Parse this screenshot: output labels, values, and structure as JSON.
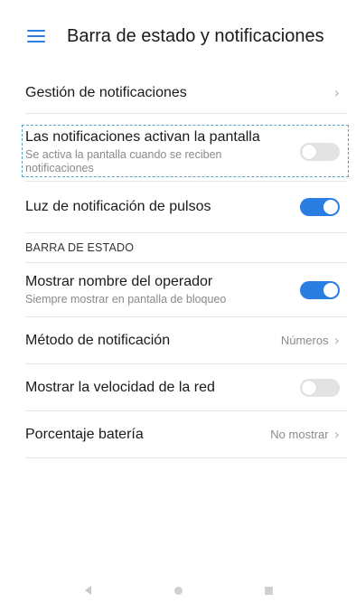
{
  "header": {
    "title": "Barra de estado y notificaciones"
  },
  "rows": {
    "notification_management": {
      "label": "Gestión de notificaciones"
    },
    "notifications_wake_screen": {
      "label": "Las notificaciones activan la pantalla",
      "sub": "Se activa la pantalla cuando se reciben notificaciones",
      "toggle": "off"
    },
    "pulse_light": {
      "label": "Luz de notificación de pulsos",
      "toggle": "on"
    },
    "section_status_bar": "BARRA DE ESTADO",
    "show_operator": {
      "label": "Mostrar nombre del operador",
      "sub": "Siempre mostrar en pantalla de bloqueo",
      "toggle": "on"
    },
    "notification_method": {
      "label": "Método de notificación",
      "value": "Números"
    },
    "network_speed": {
      "label": "Mostrar la velocidad de la red",
      "toggle": "off"
    },
    "battery_percentage": {
      "label": "Porcentaje batería",
      "value": "No mostrar"
    }
  },
  "icons": {
    "menu": "hamburger-menu-icon",
    "chevron": "chevron-right-icon",
    "back": "back-icon",
    "home": "home-icon",
    "recents": "recents-icon"
  },
  "colors": {
    "accent": "#2a7de1",
    "highlight_dash": "#55a3c9"
  }
}
